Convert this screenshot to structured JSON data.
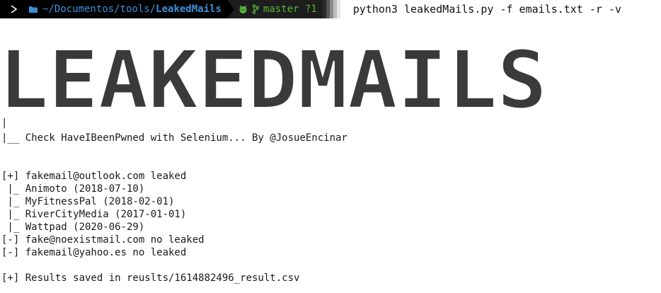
{
  "prompt": {
    "os_icon": "terminal-prompt-icon",
    "path_prefix": "~/Documentos/tools/",
    "path_current": "LeakedMails",
    "git_icon": "github-icon",
    "branch_icon": "git-branch-icon",
    "branch": "master ?1",
    "command": "python3 leakedMails.py -f emails.txt -r -v"
  },
  "banner": {
    "text": "LEAKEDMAILS",
    "color": "#3a3a3a"
  },
  "lines": {
    "pipe": "|",
    "subtitle": "|__ Check HaveIBeenPwned with Selenium... By @JosueEncinar",
    "r1": "[+] fakemail@outlook.com leaked",
    "r1_b1": " |_ Animoto (2018-07-10)",
    "r1_b2": " |_ MyFitnessPal (2018-02-01)",
    "r1_b3": " |_ RiverCityMedia (2017-01-01)",
    "r1_b4": " |_ Wattpad (2020-06-29)",
    "r2": "[-] fake@noexistmail.com no leaked",
    "r3": "[-] fakemail@yahoo.es no leaked",
    "saved": "[+] Results saved in reuslts/1614882496_result.csv"
  },
  "colors": {
    "dir": "#3d8fd6",
    "git": "#55b53a",
    "prompt_bg": "#000000",
    "git_bg": "#1d1d1d"
  }
}
